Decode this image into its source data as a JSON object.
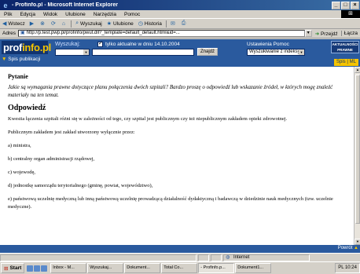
{
  "window": {
    "title": "- Profinfo.pl - Microsoft Internet Explorer",
    "minimize": "_",
    "maximize": "□",
    "close": "×"
  },
  "menu": [
    "Plik",
    "Edycja",
    "Widok",
    "Ulubione",
    "Narzędzia",
    "Pomoc"
  ],
  "toolbar": {
    "back": "Wstecz",
    "search": "Wyszukaj",
    "favorites": "Ulubione",
    "history": "Historia"
  },
  "address": {
    "label": "Adres",
    "url": "http://p.test.pwp.pl/profinfo/pwut.dll?_template=default_default.html&id=...",
    "go": "Przejdź",
    "links": "Łącza"
  },
  "site": {
    "logo_main": "prof",
    "logo_accent": "info.pl",
    "search_label": "Wyszukaj:",
    "only_current_label": "tylko aktualne w dniu 14.10.2004",
    "settings_label": "Ustawienia  Pomoc",
    "search_button": "Znajdź",
    "category_value": "",
    "search_value": "",
    "sort_value": "Wyszukiwanie z indeksy...",
    "spis_link": "Spis publikacji",
    "spis_right": "Spis | ML",
    "brand_box": "AKTUALNOŚCI PRAWNE",
    "powrot": "Powrót"
  },
  "content": {
    "h_question": "Pytanie",
    "question": "Jakie są wymagania prawne dotyczące planu połączenia dwóch szpitali? Bardzo proszę o odpowiedź lub wskazanie źródeł, w których mogę znaleźć materiały na ten temat.",
    "h_answer": "Odpowiedź",
    "paragraphs": [
      "Kwestia łączenia szpitali różni się w zależności od tego, czy szpital jest publicznym czy też niepublicznym zakładem opieki zdrowotnej.",
      "Publicznym zakładem jest zakład utworzony wyłącznie przez:",
      "a) ministra,",
      "b) centralny organ administracji rządowej,",
      "c) wojewodę,",
      "d) jednostkę samorządu terytorialnego (gminę, powiat, województwo),",
      "e) państwową uczelnię medyczną lub inną państwową uczelnię prowadzącą działalność dydaktyczną i badawczą w dziedzinie nauk medycznych (tzw. uczelnie medyczne)."
    ]
  },
  "status": {
    "zone": "Internet"
  },
  "taskbar": {
    "start": "Start",
    "tasks": [
      "Inbox - M...",
      "Wyszukaj...",
      "Dokument...",
      "Total Co...",
      "- Profinfo.p...",
      "Dokument1..."
    ],
    "active_index": 4,
    "tray": "PL 10:24"
  }
}
